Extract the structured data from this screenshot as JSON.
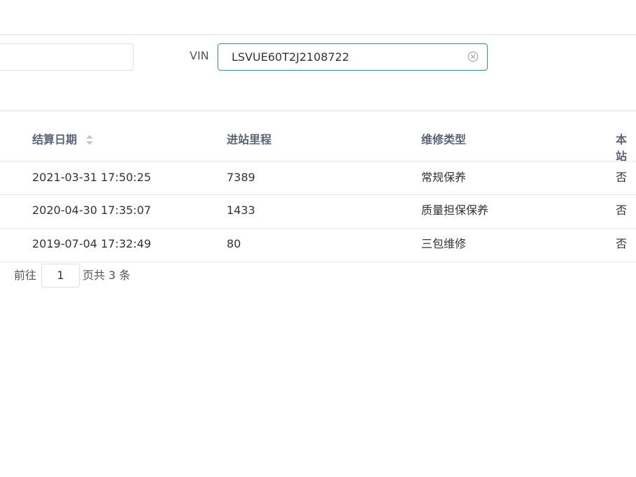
{
  "filter": {
    "vin_label": "VIN",
    "vin_value": "LSVUE60T2J2108722"
  },
  "table": {
    "headers": [
      "结算日期",
      "进站里程",
      "维修类型",
      "本站"
    ],
    "rows": [
      {
        "date": "2021-03-31 17:50:25",
        "mileage": "7389",
        "type": "常规保养",
        "local": "否"
      },
      {
        "date": "2020-04-30 17:35:07",
        "mileage": "1433",
        "type": "质量担保保养",
        "local": "否"
      },
      {
        "date": "2019-07-04 17:32:49",
        "mileage": "80",
        "type": "三包维修",
        "local": "否"
      }
    ]
  },
  "pagination": {
    "goto_label": "前往",
    "page_value": "1",
    "total_label": "页共 3 条"
  },
  "icons": {
    "clear": "circle-x-icon",
    "sort": "sort-caret-icon"
  },
  "colors": {
    "input_focus_border": "#2d8cc6",
    "header_text": "#5b6478"
  }
}
